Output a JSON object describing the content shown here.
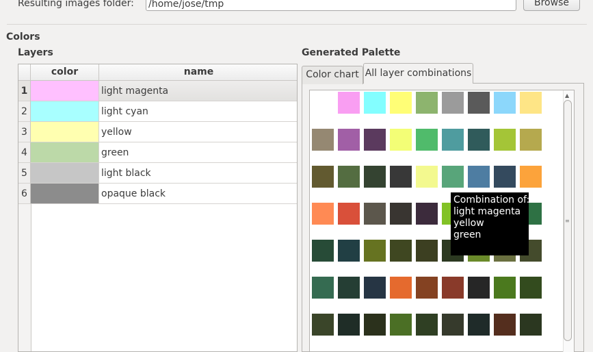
{
  "top": {
    "folder_label": "Resulting images folder:",
    "folder_value": "/home/jose/tmp",
    "browse_label": "Browse"
  },
  "section": {
    "colors_title": "Colors",
    "layers_title": "Layers",
    "palette_title": "Generated Palette"
  },
  "layers": {
    "headers": {
      "color": "color",
      "name": "name"
    },
    "rows": [
      {
        "num": "1",
        "color": "#ffc0ff",
        "name": "light magenta"
      },
      {
        "num": "2",
        "color": "#a8ffff",
        "name": "light cyan"
      },
      {
        "num": "3",
        "color": "#ffffb0",
        "name": "yellow"
      },
      {
        "num": "4",
        "color": "#bcd9a8",
        "name": "green"
      },
      {
        "num": "5",
        "color": "#c6c6c6",
        "name": "light black"
      },
      {
        "num": "6",
        "color": "#8c8c8c",
        "name": "opaque black"
      }
    ],
    "selected_row": "1"
  },
  "tabs": [
    {
      "label": "Color chart",
      "active": false
    },
    {
      "label": "All layer combinations",
      "active": true
    }
  ],
  "palette": {
    "rows": [
      [
        "#ffffff",
        "#f99ef2",
        "#83feff",
        "#fffe76",
        "#8db46e",
        "#9b9b9b",
        "#5a5a5a",
        "#8cd7fb",
        "#fee586"
      ],
      [
        "#958872",
        "#a15fa6",
        "#5b3a5e",
        "#f3fe76",
        "#50bb6b",
        "#4f9c9f",
        "#305b5b",
        "#a4c537",
        "#b5a94e"
      ],
      [
        "#625a30",
        "#546d41",
        "#344331",
        "#383838",
        "#f3f98f",
        "#58a57a",
        "#4e7da2",
        "#344a5e",
        "#fca33b"
      ],
      [
        "#ff8a54",
        "#d9503a",
        "#5c574c",
        "#393531",
        "#3c2b3c",
        "#82c226",
        "#7e9b5d",
        "#53632d",
        "#2e7144"
      ],
      [
        "#274b37",
        "#213f44",
        "#667321",
        "#3f4721",
        "#3c3f21",
        "#2c3921",
        "#6a8a2a",
        "#6a7040",
        "#444b2c"
      ],
      [
        "#356b51",
        "#253e34",
        "#263544",
        "#e56a2e",
        "#844222",
        "#893a2a",
        "#262626",
        "#4b791e",
        "#334b1e"
      ],
      [
        "#3a4529",
        "#1f2d27",
        "#2b311c",
        "#4b6f25",
        "#2f3f23",
        "#363a2c",
        "#1f2b29",
        "#542e1e",
        "#2b3720"
      ]
    ]
  },
  "tooltip": {
    "lines": [
      "Combination of:",
      "light magenta",
      "yellow",
      "green"
    ]
  }
}
